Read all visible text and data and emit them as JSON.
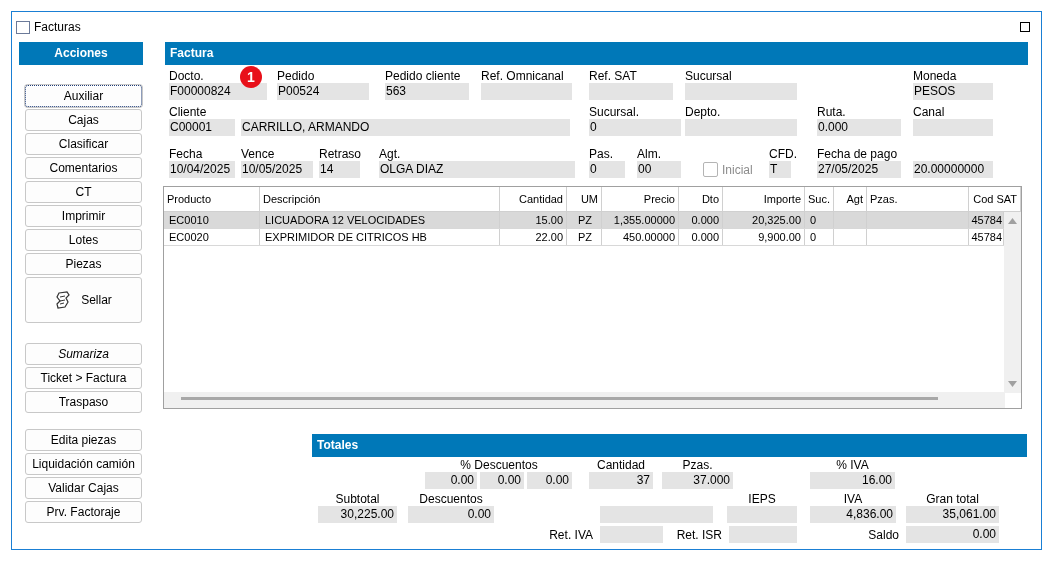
{
  "window": {
    "title": "Facturas"
  },
  "sidebar": {
    "title": "Acciones",
    "groups": [
      [
        {
          "label": "Auxiliar",
          "focused": true,
          "kind": "button"
        },
        {
          "label": "Cajas",
          "focused": false,
          "kind": "button"
        },
        {
          "label": "Clasificar",
          "focused": false,
          "kind": "button"
        },
        {
          "label": "Comentarios",
          "focused": false,
          "kind": "button"
        },
        {
          "label": "CT",
          "focused": false,
          "kind": "button"
        },
        {
          "label": "Imprimir",
          "focused": false,
          "kind": "button"
        },
        {
          "label": "Lotes",
          "focused": false,
          "kind": "button"
        },
        {
          "label": "Piezas",
          "focused": false,
          "kind": "button"
        },
        {
          "label": "Sellar",
          "focused": false,
          "kind": "icon-button"
        }
      ],
      [
        {
          "label": "Sumariza",
          "focused": false,
          "kind": "italic-button"
        },
        {
          "label": "Ticket > Factura",
          "focused": false,
          "kind": "button"
        },
        {
          "label": "Traspaso",
          "focused": false,
          "kind": "button"
        }
      ],
      [
        {
          "label": "Edita piezas",
          "focused": false,
          "kind": "button"
        },
        {
          "label": "Liquidación camión",
          "focused": false,
          "kind": "button"
        },
        {
          "label": "Validar Cajas",
          "focused": false,
          "kind": "button"
        },
        {
          "label": "Prv. Factoraje",
          "focused": false,
          "kind": "button"
        }
      ]
    ]
  },
  "factura": {
    "title": "Factura",
    "rows": [
      {
        "fields": [
          {
            "kind": "field",
            "label": "Docto.",
            "value": "F00000824",
            "badge": "1"
          },
          {
            "kind": "field",
            "label": "Pedido",
            "value": "P00524"
          },
          {
            "kind": "field",
            "label": "Pedido cliente",
            "value": "563"
          },
          {
            "kind": "field",
            "label": "Ref. Omnicanal"
          },
          {
            "kind": "field",
            "label": "Ref. SAT"
          },
          {
            "kind": "field",
            "label": "Sucursal"
          },
          {
            "kind": "field",
            "label": "Moneda",
            "value": "PESOS"
          }
        ]
      },
      {
        "fields": [
          {
            "kind": "field",
            "label": "Cliente",
            "value": "C00001"
          },
          {
            "kind": "field",
            "value": "CARRILLO, ARMANDO"
          },
          {
            "kind": "field",
            "label": "Sucursal.",
            "value": "0"
          },
          {
            "kind": "field",
            "label": "Depto."
          },
          {
            "kind": "field",
            "label": "Ruta.",
            "value": "0.000"
          },
          {
            "kind": "field",
            "label": "Canal"
          }
        ]
      },
      {
        "fields": [
          {
            "kind": "field",
            "label": "Fecha",
            "value": "10/04/2025"
          },
          {
            "kind": "field",
            "label": "Vence",
            "value": "10/05/2025"
          },
          {
            "kind": "field",
            "label": "Retraso",
            "value": "14"
          },
          {
            "kind": "field",
            "label": "Agt.",
            "value": "OLGA DIAZ"
          },
          {
            "kind": "field",
            "label": "Pas.",
            "value": "0"
          },
          {
            "kind": "field",
            "label": "Alm.",
            "value": "00"
          },
          {
            "kind": "checkbox",
            "label": "Inicial",
            "checked": false,
            "disabled": true
          },
          {
            "kind": "field",
            "label": "CFD.",
            "value": "T"
          },
          {
            "kind": "field",
            "label": "Fecha de pago",
            "value": "27/05/2025"
          },
          {
            "kind": "field",
            "value": "20.00000000"
          }
        ]
      }
    ]
  },
  "table": {
    "columns": [
      "Producto",
      "Descripción",
      "Cantidad",
      "UM",
      "Precio",
      "Dto",
      "Importe",
      "Suc.",
      "Agt",
      "Pzas.",
      "Cod SAT"
    ],
    "rows": [
      {
        "selected": true,
        "cells": [
          "EC0010",
          "LICUADORA 12 VELOCIDADES",
          "15.00",
          "PZ",
          "1,355.00000",
          "0.000",
          "20,325.00",
          "0",
          "",
          "",
          "45784"
        ]
      },
      {
        "selected": false,
        "cells": [
          "EC0020",
          "EXPRIMIDOR DE CITRICOS HB",
          "22.00",
          "PZ",
          "450.00000",
          "0.000",
          "9,900.00",
          "0",
          "",
          "",
          "45784"
        ]
      }
    ]
  },
  "totales": {
    "title": "Totales",
    "rows": [
      {
        "fields": [
          {
            "kind": "group",
            "label": "% Descuentos",
            "values": [
              "0.00",
              "0.00",
              "0.00"
            ]
          },
          {
            "kind": "field",
            "label": "Cantidad",
            "value": "37"
          },
          {
            "kind": "field",
            "label": "Pzas.",
            "value": "37.000"
          },
          {
            "kind": "field",
            "label": "% IVA",
            "value": "16.00"
          }
        ]
      },
      {
        "fields": [
          {
            "kind": "field",
            "label": "Subtotal",
            "value": "30,225.00"
          },
          {
            "kind": "field",
            "label": "Descuentos",
            "value": "0.00"
          },
          {
            "kind": "field"
          },
          {
            "kind": "field",
            "label": "IEPS"
          },
          {
            "kind": "field",
            "label": "IVA",
            "value": "4,836.00"
          },
          {
            "kind": "field",
            "label": "Gran total",
            "value": "35,061.00"
          }
        ]
      },
      {
        "fields": [
          {
            "kind": "inline",
            "label": "Ret. IVA"
          },
          {
            "kind": "inline",
            "label": "Ret. ISR"
          },
          {
            "kind": "inline",
            "label": "Saldo",
            "value": "0.00"
          }
        ]
      }
    ]
  }
}
